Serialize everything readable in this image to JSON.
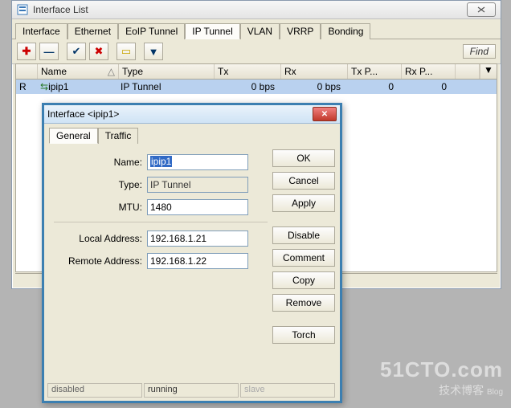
{
  "main_window": {
    "title": "Interface List",
    "tabs": [
      "Interface",
      "Ethernet",
      "EoIP Tunnel",
      "IP Tunnel",
      "VLAN",
      "VRRP",
      "Bonding"
    ],
    "active_tab": 3,
    "find_label": "Find",
    "columns": {
      "name": "Name",
      "type": "Type",
      "tx": "Tx",
      "rx": "Rx",
      "txp": "Tx P...",
      "rxp": "Rx P..."
    },
    "row": {
      "flag": "R",
      "name": "ipip1",
      "type": "IP Tunnel",
      "tx": "0 bps",
      "rx": "0 bps",
      "txp": "0",
      "rxp": "0"
    }
  },
  "dialog": {
    "title": "Interface <ipip1>",
    "tabs": [
      "General",
      "Traffic"
    ],
    "active_tab": 0,
    "fields": {
      "name_label": "Name:",
      "name_value": "ipip1",
      "type_label": "Type:",
      "type_value": "IP Tunnel",
      "mtu_label": "MTU:",
      "mtu_value": "1480",
      "local_label": "Local Address:",
      "local_value": "192.168.1.21",
      "remote_label": "Remote Address:",
      "remote_value": "192.168.1.22"
    },
    "buttons": {
      "ok": "OK",
      "cancel": "Cancel",
      "apply": "Apply",
      "disable": "Disable",
      "comment": "Comment",
      "copy": "Copy",
      "remove": "Remove",
      "torch": "Torch"
    },
    "status": {
      "s1": "disabled",
      "s2": "running",
      "s3": "slave"
    }
  },
  "watermark": {
    "line1": "51CTO.com",
    "line2": "技术博客",
    "line3": "Blog"
  }
}
